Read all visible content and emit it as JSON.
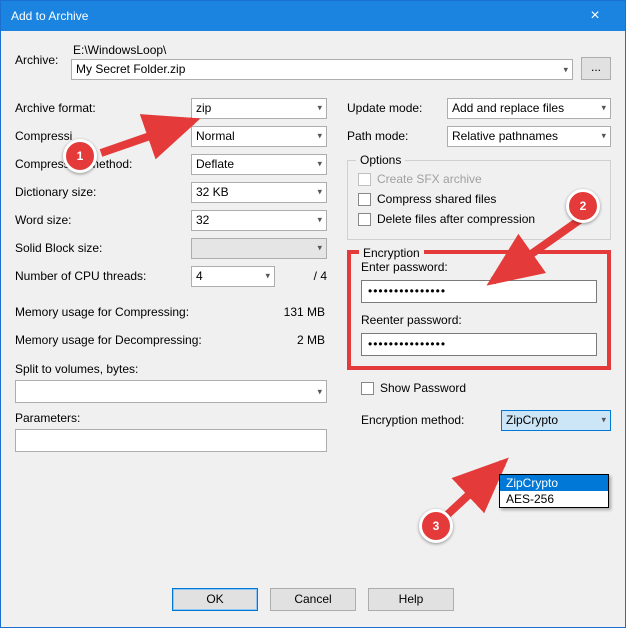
{
  "title": "Add to Archive",
  "archive": {
    "label": "Archive:",
    "path_dir": "E:\\WindowsLoop\\",
    "filename": "My Secret Folder.zip",
    "browse": "..."
  },
  "left": {
    "format_label": "Archive format:",
    "format_value": "zip",
    "comp_level_label": "Compressi",
    "comp_level_value": "Normal",
    "comp_method_label": "Compression method:",
    "comp_method_value": "Deflate",
    "dict_label": "Dictionary size:",
    "dict_value": "32 KB",
    "word_label": "Word size:",
    "word_value": "32",
    "solid_label": "Solid Block size:",
    "solid_value": "",
    "cpu_label": "Number of CPU threads:",
    "cpu_value": "4",
    "cpu_total": "/ 4",
    "mem_comp_label": "Memory usage for Compressing:",
    "mem_comp_value": "131 MB",
    "mem_decomp_label": "Memory usage for Decompressing:",
    "mem_decomp_value": "2 MB",
    "split_label": "Split to volumes, bytes:",
    "params_label": "Parameters:"
  },
  "right": {
    "update_label": "Update mode:",
    "update_value": "Add and replace files",
    "path_label": "Path mode:",
    "path_value": "Relative pathnames",
    "options_legend": "Options",
    "opt_sfx": "Create SFX archive",
    "opt_shared": "Compress shared files",
    "opt_delete": "Delete files after compression",
    "enc_legend": "Encryption",
    "enter_pwd": "Enter password:",
    "reenter_pwd": "Reenter password:",
    "pwd_mask": "•••••••••••••••",
    "show_pwd": "Show Password",
    "enc_method_label": "Encryption method:",
    "enc_method_value": "ZipCrypto",
    "enc_options": [
      "ZipCrypto",
      "AES-256"
    ]
  },
  "buttons": {
    "ok": "OK",
    "cancel": "Cancel",
    "help": "Help"
  },
  "callouts": {
    "one": "1",
    "two": "2",
    "three": "3"
  }
}
